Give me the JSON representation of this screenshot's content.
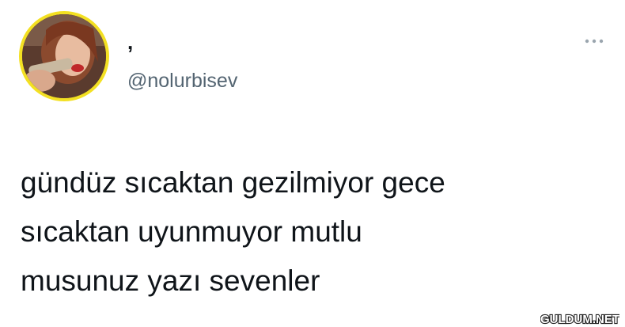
{
  "tweet": {
    "display_name": ",",
    "handle": "@nolurbisev",
    "text": "gündüz sıcaktan gezilmiyor gece\nsıcaktan uyunmuyor mutlu\nmusunuz yazı sevenler",
    "avatar_icon": "profile-photo",
    "more_icon": "more-options-icon"
  },
  "watermark": {
    "text": "GULDUM.NET"
  },
  "colors": {
    "avatar_ring": "#f3e022",
    "text": "#0f1419",
    "handle": "#536471",
    "more_icon": "#9aa5ae"
  }
}
